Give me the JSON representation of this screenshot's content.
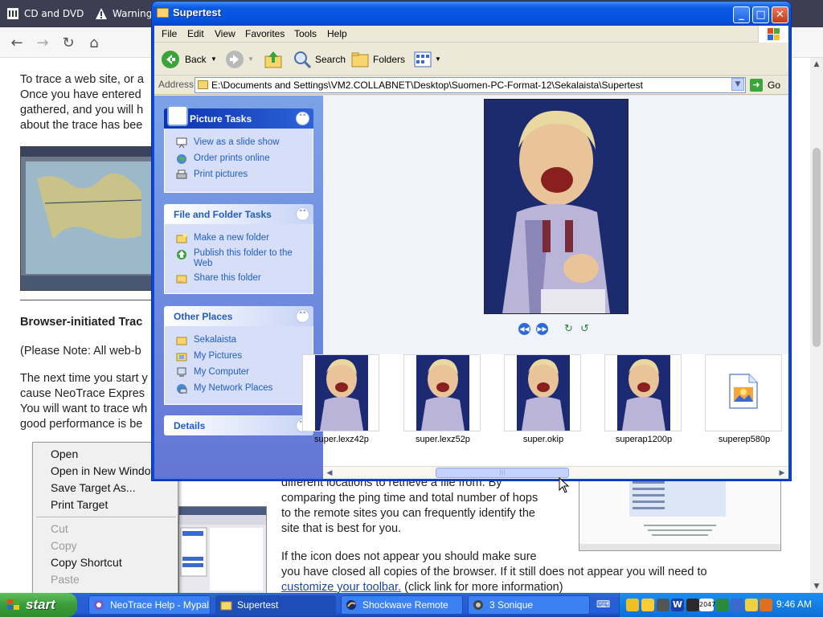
{
  "browser": {
    "tabs": [
      {
        "label": "CD and DVD"
      },
      {
        "label": "Warnings"
      }
    ],
    "doc": {
      "intro_lines": [
        "To trace a web site, or a",
        "Once you have entered",
        "gathered, and you will h",
        "about the trace has bee"
      ],
      "heading": "Browser-initiated Trac",
      "note": "(Please Note: All web-b",
      "para_lines": [
        "The next time you start y",
        "cause NeoTrace Expres",
        "You will want to trace wh",
        "good performance is be"
      ],
      "right_lines": [
        "different locations to retrieve a file from.  By",
        "comparing the ping time and total number of hops",
        "to the remote sites you can frequently identify the",
        "site that is best for you."
      ],
      "bottom_lines": [
        "If the icon does not appear you should make sure",
        "you have closed all copies of the browser.  If it still does not appear you will need to"
      ],
      "link": "customize your toolbar.",
      "link_tail": " (click link for more information)"
    },
    "context_menu": {
      "items": [
        "Open",
        "Open in New Window",
        "Save Target As...",
        "Print Target"
      ],
      "disabled_items": [
        "Cut",
        "Copy"
      ],
      "item_copy_shortcut": "Copy Shortcut",
      "item_paste": "Paste"
    }
  },
  "explorer": {
    "title": "Supertest",
    "menu": [
      "File",
      "Edit",
      "View",
      "Favorites",
      "Tools",
      "Help"
    ],
    "toolbar": {
      "back": "Back",
      "search": "Search",
      "folders": "Folders"
    },
    "address_label": "Address",
    "address": "E:\\Documents and Settings\\VM2.COLLABNET\\Desktop\\Suomen-PC-Format-12\\Sekalaista\\Supertest",
    "go": "Go",
    "picture_tasks": {
      "title": "Picture Tasks",
      "items": [
        "View as a slide show",
        "Order prints online",
        "Print pictures"
      ]
    },
    "file_tasks": {
      "title": "File and Folder Tasks",
      "items": [
        "Make a new folder",
        "Publish this folder to the Web",
        "Share this folder"
      ]
    },
    "other_places": {
      "title": "Other Places",
      "items": [
        "Sekalaista",
        "My Pictures",
        "My Computer",
        "My Network Places"
      ]
    },
    "details": {
      "title": "Details"
    },
    "files": [
      {
        "name": "super.lexz42p"
      },
      {
        "name": "super.lexz52p"
      },
      {
        "name": "super.okip"
      },
      {
        "name": "superap1200p"
      },
      {
        "name": "superep580p"
      }
    ]
  },
  "taskbar": {
    "start": "start",
    "buttons": [
      "NeoTrace Help - Mypal",
      "Supertest",
      "Shockwave Remote",
      "3 Sonique"
    ],
    "clock": "9:46 AM",
    "tray_badge": "2047"
  },
  "colors": {
    "xp_blue": "#0a46d8",
    "taskpane_link": "#215dc6",
    "start_green": "#3c9b3a"
  }
}
